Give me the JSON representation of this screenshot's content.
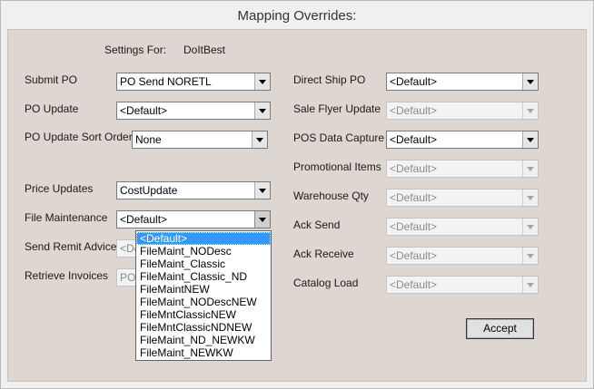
{
  "window": {
    "title": "Mapping Overrides:"
  },
  "settings": {
    "label": "Settings For:",
    "value": "DoItBest"
  },
  "left": {
    "submit_po": {
      "label": "Submit PO",
      "value": "PO Send NORETL"
    },
    "po_update": {
      "label": "PO Update",
      "value": "<Default>"
    },
    "po_update_sort": {
      "label": "PO Update Sort Order:",
      "value": "None"
    },
    "price_updates": {
      "label": "Price Updates",
      "value": "CostUpdate"
    },
    "file_maintenance": {
      "label": "File Maintenance",
      "value": "<Default>"
    },
    "send_remit": {
      "label": "Send Remit Advice",
      "value": "<De"
    },
    "retrieve_invoices": {
      "label": "Retrieve Invoices",
      "value": "POa"
    }
  },
  "right": {
    "direct_ship_po": {
      "label": "Direct Ship PO",
      "value": "<Default>"
    },
    "sale_flyer": {
      "label": "Sale Flyer Update",
      "value": "<Default>"
    },
    "pos_data": {
      "label": "POS Data Capture",
      "value": "<Default>"
    },
    "promotional": {
      "label": "Promotional Items",
      "value": "<Default>"
    },
    "warehouse_qty": {
      "label": "Warehouse Qty",
      "value": "<Default>"
    },
    "ack_send": {
      "label": "Ack Send",
      "value": "<Default>"
    },
    "ack_receive": {
      "label": "Ack Receive",
      "value": "<Default>"
    },
    "catalog_load": {
      "label": "Catalog Load",
      "value": "<Default>"
    }
  },
  "dropdown": {
    "options": [
      "<Default>",
      "FileMaint_NODesc",
      "FileMaint_Classic",
      "FileMaint_Classic_ND",
      "FileMaintNEW",
      "FileMaint_NODescNEW",
      "FileMntClassicNEW",
      "FileMntClassicNDNEW",
      "FileMaint_ND_NEWKW",
      "FileMaint_NEWKW"
    ],
    "selected_index": 0
  },
  "buttons": {
    "accept": "Accept"
  }
}
